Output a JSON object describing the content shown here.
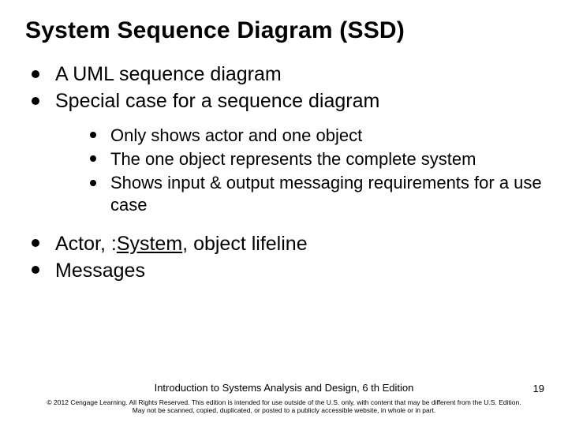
{
  "title": "System Sequence Diagram (SSD)",
  "bullets": {
    "b1": "A UML sequence diagram",
    "b2": "Special case for a sequence diagram",
    "sub1": "Only shows actor and one object",
    "sub2": "The one object represents the complete system",
    "sub3": "Shows input & output messaging requirements for a use case",
    "b3_prefix": "Actor, :",
    "b3_underlined": "System",
    "b3_suffix": ", object lifeline",
    "b4": "Messages"
  },
  "footer": {
    "book": "Introduction to Systems Analysis and Design, 6 th Edition",
    "copyright1": "© 2012 Cengage Learning. All Rights Reserved. This edition is intended for use outside of the U.S. only, with content that may be different from the U.S. Edition.",
    "copyright2": "May not be scanned, copied, duplicated, or posted to a publicly accessible website, in whole or in part."
  },
  "page_number": "19"
}
